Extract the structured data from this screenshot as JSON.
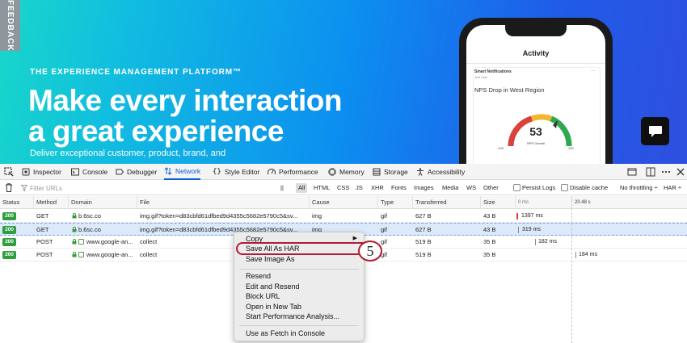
{
  "hero": {
    "feedback_label": "FEEDBACK",
    "tagline": "THE EXPERIENCE MANAGEMENT PLATFORM™",
    "headline_line1": "Make every interaction",
    "headline_line2": "a great experience",
    "subline": "Deliver exceptional customer, product, brand, and",
    "phone": {
      "title": "Activity",
      "notification_title": "Smart Notifications",
      "notification_time": "Just now",
      "menu_dots": "···",
      "card_heading": "NPS Drop in West Region",
      "gauge_value": "53",
      "gauge_caption": "NPS Overall",
      "gauge_min": "-100",
      "gauge_max": "100"
    },
    "chat_icon": "chat-bubble-icon"
  },
  "devtools": {
    "tabs": [
      "Inspector",
      "Console",
      "Debugger",
      "Network",
      "Style Editor",
      "Performance",
      "Memory",
      "Storage",
      "Accessibility"
    ],
    "active_tab": "Network",
    "filter_placeholder": "Filter URLs",
    "pause_glyph": "||",
    "type_filters": [
      "All",
      "HTML",
      "CSS",
      "JS",
      "XHR",
      "Fonts",
      "Images",
      "Media",
      "WS",
      "Other"
    ],
    "active_type_filter": "All",
    "persist_logs": "Persist Logs",
    "disable_cache": "Disable cache",
    "throttling": "No throttling ÷",
    "har_menu": "HAR ÷",
    "columns": [
      "Status",
      "Method",
      "Domain",
      "File",
      "Cause",
      "Type",
      "Transferred",
      "Size"
    ],
    "waterfall_ticks": [
      "0 ms",
      "20.48 s"
    ],
    "rows": [
      {
        "status": "200",
        "method": "GET",
        "domain": "b.6sc.co",
        "file": "img.gif?token=d83cbfd61dfbed9d4355c5682e5790c5&sv...",
        "cause": "img",
        "type": "gif",
        "transferred": "627 B",
        "size": "43 B",
        "timing": "1397 ms",
        "secure": true,
        "selected": false
      },
      {
        "status": "200",
        "method": "GET",
        "domain": "b.6sc.co",
        "file": "img.gif?token=d83cbfd61dfbed9d4355c5682e5790c5&sv...",
        "cause": "img",
        "type": "gif",
        "transferred": "627 B",
        "size": "43 B",
        "timing": "319 ms",
        "secure": true,
        "selected": true
      },
      {
        "status": "200",
        "method": "POST",
        "domain": "www.google-an...",
        "file": "collect",
        "cause": "",
        "type": "gif",
        "transferred": "519 B",
        "size": "35 B",
        "timing": "182 ms",
        "secure": true,
        "selected": false
      },
      {
        "status": "200",
        "method": "POST",
        "domain": "www.google-an...",
        "file": "collect",
        "cause": "",
        "type": "gif",
        "transferred": "519 B",
        "size": "35 B",
        "timing": "184 ms",
        "secure": true,
        "selected": false
      }
    ]
  },
  "context_menu": {
    "copy": "Copy",
    "save_all_har": "Save All As HAR",
    "save_image": "Save Image As",
    "resend": "Resend",
    "edit_resend": "Edit and Resend",
    "block_url": "Block URL",
    "open_new_tab": "Open in New Tab",
    "start_perf": "Start Performance Analysis...",
    "use_fetch": "Use as Fetch in Console",
    "submenu_arrow": "▶"
  },
  "annotation": {
    "step_number": "5",
    "highlight_color": "#b31b34"
  },
  "colors": {
    "status_ok": "#2e9e3e",
    "active_tab": "#0a60d6",
    "selection": "#dbe9fb"
  }
}
